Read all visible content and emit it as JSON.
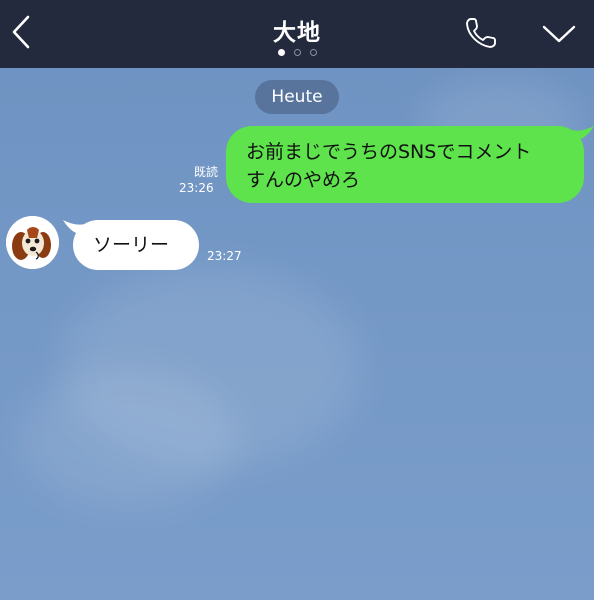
{
  "header": {
    "title": "大地",
    "page_dots": 3,
    "active_dot": 0,
    "back_icon": "chevron-left-icon",
    "call_icon": "phone-icon",
    "menu_icon": "chevron-down-icon",
    "background_color": "#242a3e"
  },
  "chat": {
    "date_separator": "Heute",
    "background_color": "#7196c4",
    "messages": [
      {
        "direction": "outgoing",
        "lines": [
          "お前まじでうちのSNSでコメント",
          "すんのやめろ"
        ],
        "read_label": "既読",
        "time": "23:26",
        "bubble_color": "#5ee34d"
      },
      {
        "direction": "incoming",
        "text": "ソーリー",
        "time": "23:27",
        "avatar_icon": "dog-avatar-icon",
        "bubble_color": "#ffffff"
      }
    ]
  }
}
